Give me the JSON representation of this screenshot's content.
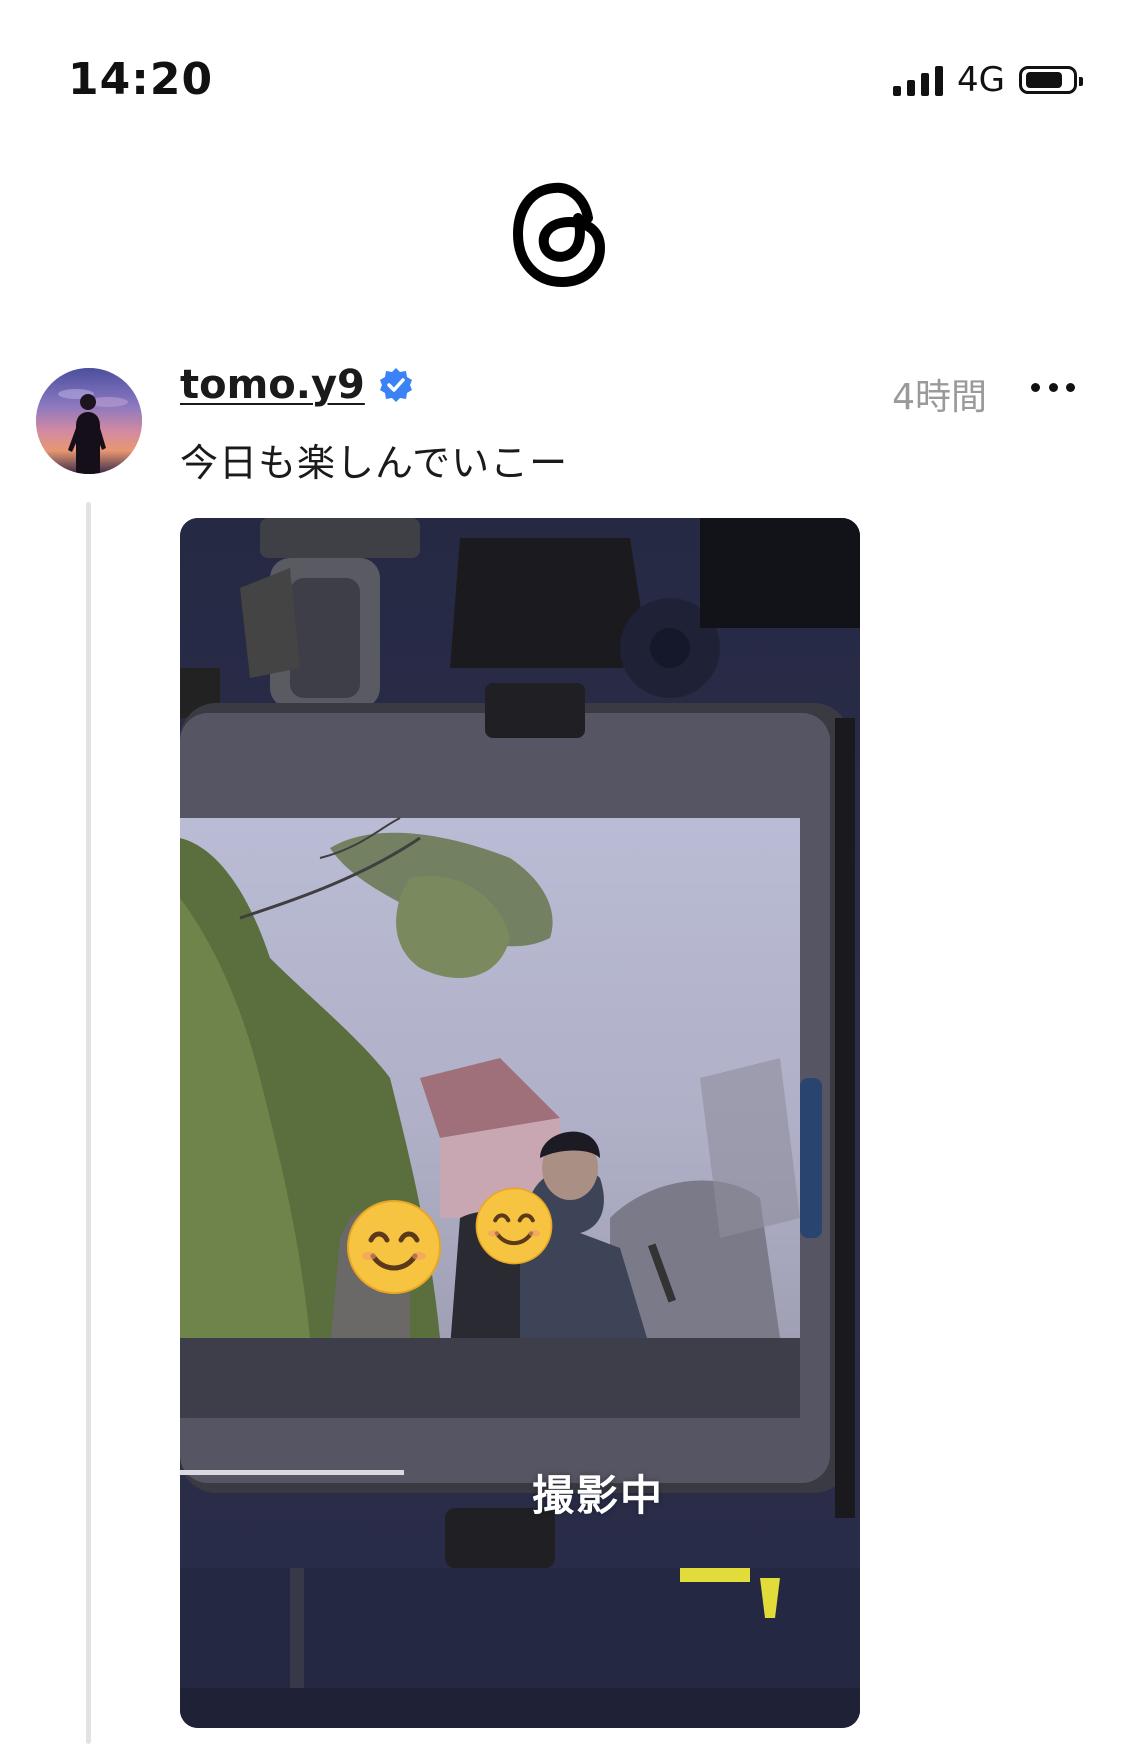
{
  "status_bar": {
    "time": "14:20",
    "network": "4G",
    "signal_bars": 4,
    "battery_level": 0.75
  },
  "header": {
    "logo_icon": "threads-logo-icon"
  },
  "post": {
    "username": "tomo.y9",
    "verified": true,
    "timestamp": "4時間",
    "text": "今日も楽しんでいこー",
    "more_icon": "more-horizontal-icon",
    "media": {
      "caption": "撮影中",
      "stickers": [
        "smiling-face-emoji",
        "smiling-face-emoji"
      ]
    }
  },
  "colors": {
    "verified_badge": "#3b82f6",
    "timestamp": "#9a9a9a",
    "thread_line": "#e2e2e2",
    "text": "#1a1a1a"
  }
}
